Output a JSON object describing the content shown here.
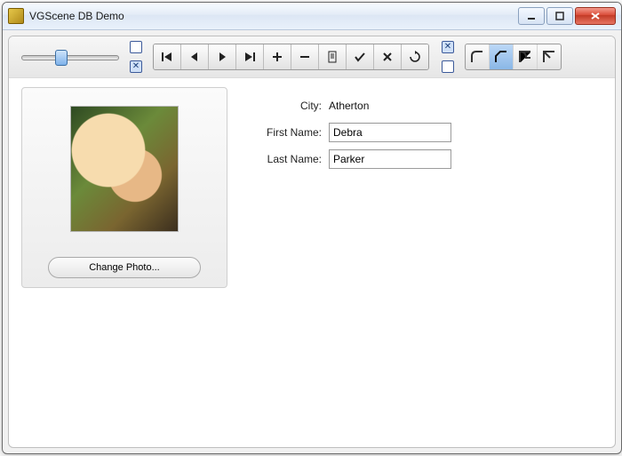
{
  "window": {
    "title": "VGScene DB Demo"
  },
  "toolbar": {
    "check_top": false,
    "check_bottom_left": true,
    "check_top_right": true,
    "check_bottom_right": false,
    "corner_selected_index": 1
  },
  "photo": {
    "change_label": "Change Photo..."
  },
  "fields": {
    "city_label": "City:",
    "city_value": "Atherton",
    "first_name_label": "First Name:",
    "first_name_value": "Debra",
    "last_name_label": "Last Name:",
    "last_name_value": "Parker"
  }
}
